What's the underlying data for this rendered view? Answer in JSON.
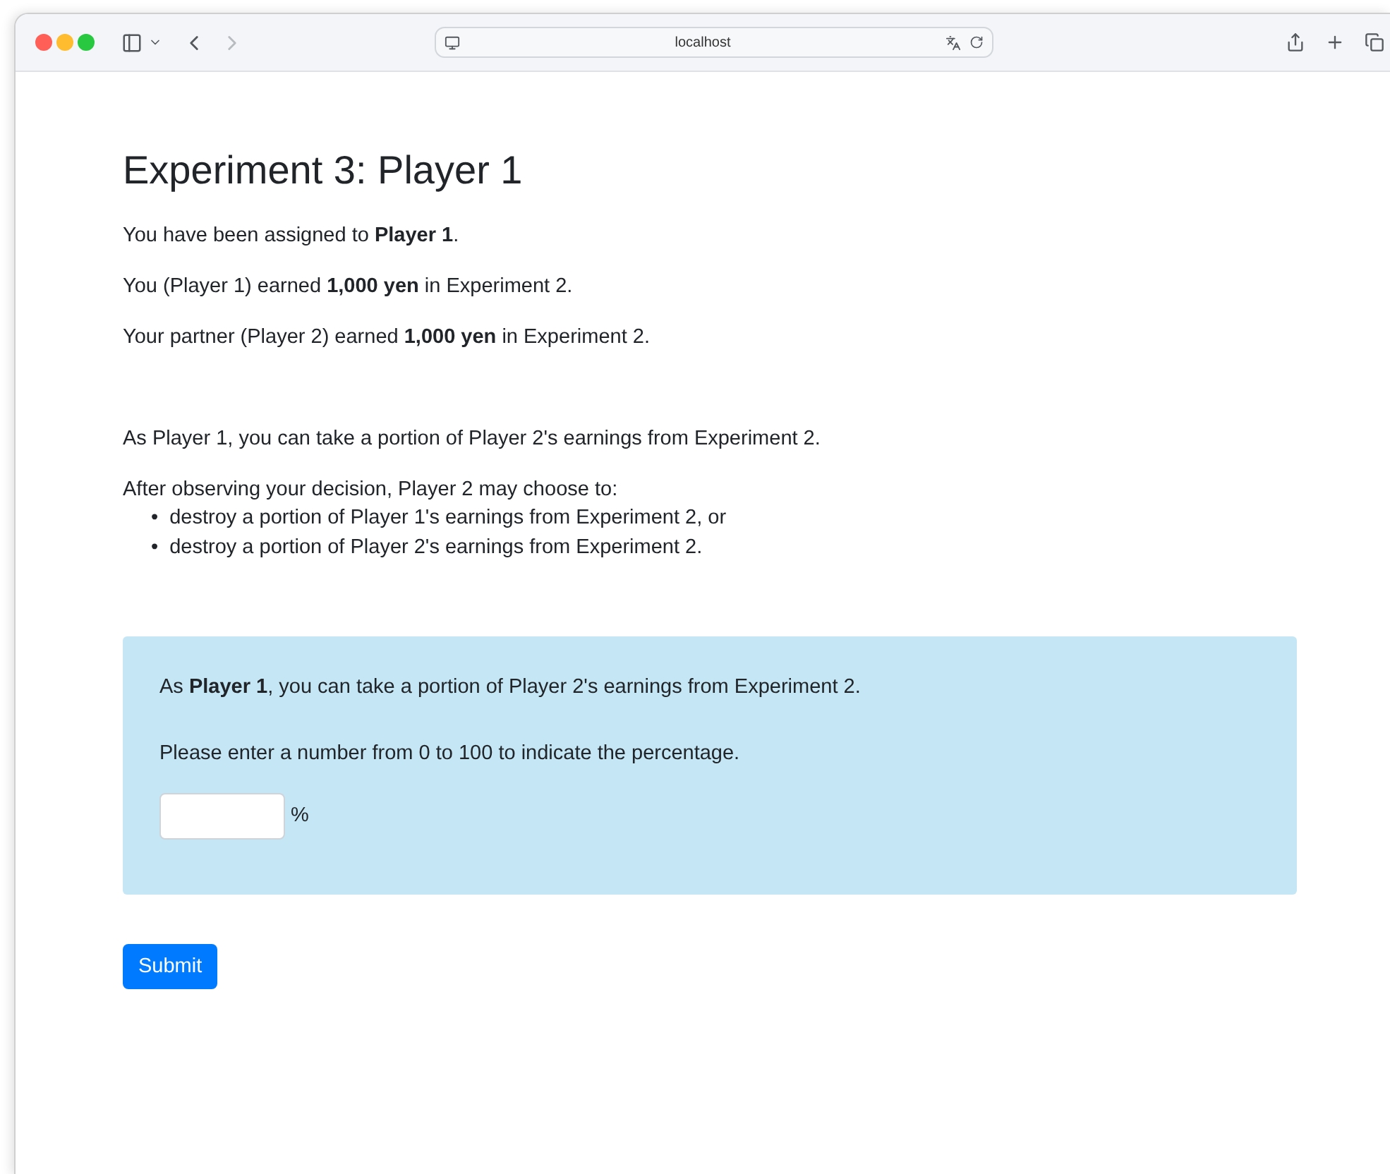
{
  "browser": {
    "address": "localhost",
    "back_disabled": false,
    "forward_disabled": true
  },
  "page": {
    "title": "Experiment 3: Player 1",
    "intro": [
      "You have been assigned to **Player 1**.",
      "You (Player 1) earned **1,000 yen** in Experiment 2.",
      "Your partner (Player 2) earned **1,000 yen** in Experiment 2."
    ],
    "rule": "As Player 1, you can take a portion of Player 2's earnings from Experiment 2.",
    "choice_intro": "After observing your decision, Player 2 may choose to:",
    "choices": [
      {
        "marker": "•",
        "text": "destroy a portion of Player 1's earnings from Experiment 2, or"
      },
      {
        "marker": "•",
        "text": "destroy a portion of Player 2's earnings from Experiment 2."
      }
    ],
    "panel": {
      "prompt": "As **Player 1**, you can take a portion of Player 2's earnings from Experiment 2.",
      "instruction": "Please enter a number from 0 to 100 to indicate the percentage.",
      "unit": "%"
    },
    "submit": "Submit"
  }
}
